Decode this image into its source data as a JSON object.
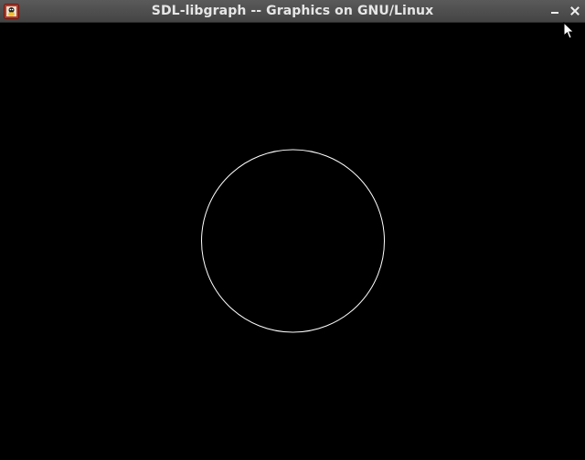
{
  "window": {
    "title": "SDL-libgraph -- Graphics on GNU/Linux",
    "titlebar_color": "#4b4b4b",
    "title_text_color": "#e6e6e6"
  },
  "controls": {
    "minimize_icon": "minimize-icon",
    "close_icon": "close-icon"
  },
  "canvas": {
    "background": "#000000",
    "shape": "circle",
    "stroke_color": "#ffffff"
  }
}
